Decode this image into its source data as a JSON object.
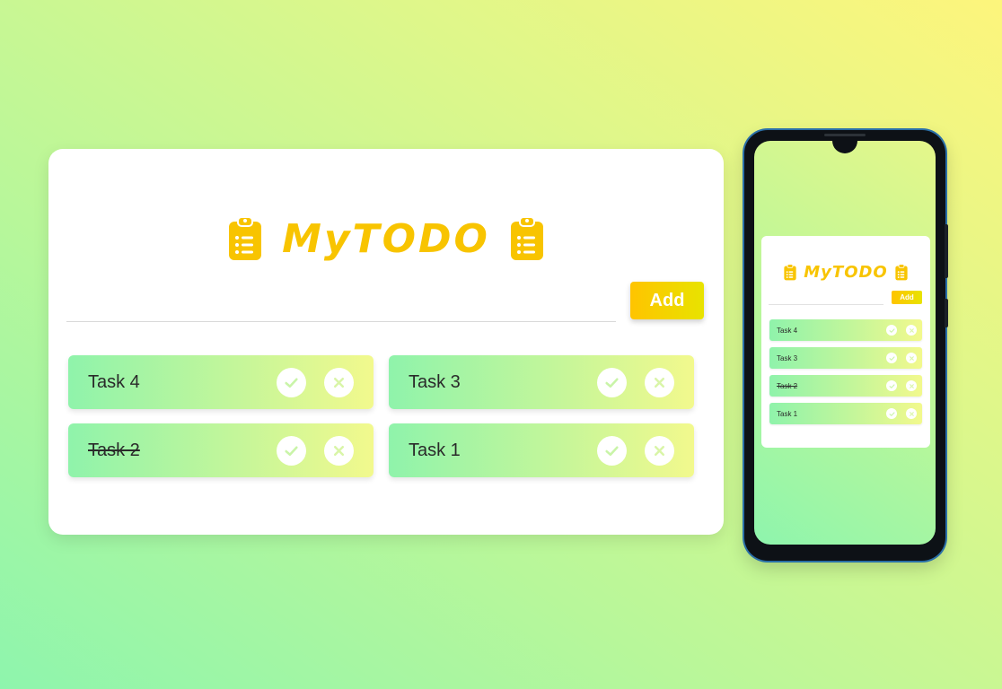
{
  "app": {
    "title": "MyTODO",
    "add_label": "Add",
    "input_value": "",
    "accent_color": "#f8c400",
    "icons": {
      "title_icon": "clipboard-list-icon",
      "complete": "check-icon",
      "delete": "close-icon"
    }
  },
  "tasks": [
    {
      "label": "Task 4",
      "completed": false
    },
    {
      "label": "Task 3",
      "completed": false
    },
    {
      "label": "Task 2",
      "completed": true
    },
    {
      "label": "Task 1",
      "completed": false
    }
  ]
}
